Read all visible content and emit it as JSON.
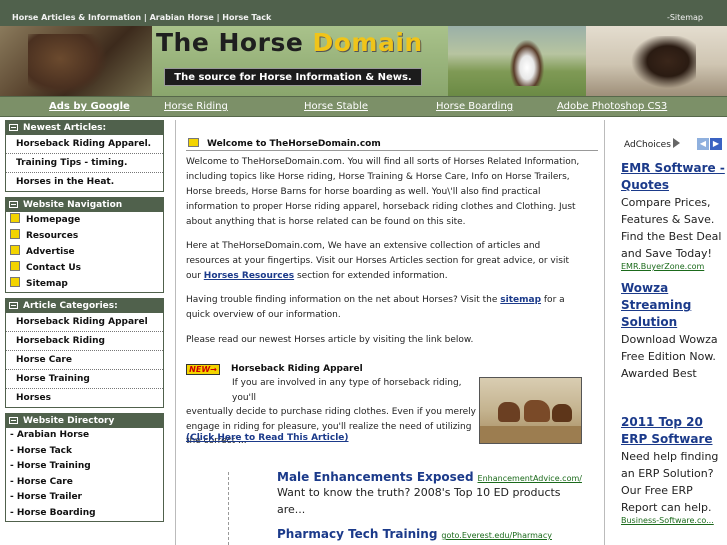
{
  "topbar": {
    "crumbs": "Horse Articles & Information | Arabian Horse | Horse Tack",
    "sitemap": "-Sitemap"
  },
  "banner": {
    "title_part1": "The Horse ",
    "title_part2": "Domain",
    "tagline": "The source for Horse Information & News."
  },
  "nav": {
    "items": [
      "Ads by Google",
      "Horse Riding",
      "Horse Stable",
      "Horse Boarding",
      "Adobe Photoshop CS3"
    ]
  },
  "sidebar": {
    "newest": {
      "heading": "Newest Articles:",
      "items": [
        "Horseback Riding Apparel.",
        "Training Tips - timing.",
        "Horses in the Heat."
      ]
    },
    "navigation": {
      "heading": "Website Navigation",
      "items": [
        "Homepage",
        "Resources",
        "Advertise",
        "Contact Us",
        "Sitemap"
      ]
    },
    "categories": {
      "heading": "Article Categories:",
      "items": [
        "Horseback Riding Apparel",
        "Horseback Riding",
        "Horse Care",
        "Horse Training",
        "Horses"
      ]
    },
    "directory": {
      "heading": "Website Directory",
      "items": [
        "- Arabian Horse",
        "- Horse Tack",
        "- Horse Training",
        "- Horse Care",
        "- Horse Trailer",
        "- Horse Boarding"
      ]
    }
  },
  "main": {
    "welcome": "Welcome to TheHorseDomain.com",
    "p1": "Welcome to TheHorseDomain.com. You will find all sorts of Horses Related Information, including topics like Horse riding, Horse Training & Horse Care, Info on Horse Trailers, Horse breeds, Horse Barns for horse boarding as well. You\\'ll also find practical information to proper Horse riding apparel, horseback riding clothes and Clothing. Just about anything that is horse related can be found on this site.",
    "p2_a": "Here at TheHorseDomain.com, We have an extensive collection of articles and resources at your fingertips. Visit our Horses Articles section for great advice, or visit our ",
    "p2_link": "Horses Resources",
    "p2_b": " section for extended information.",
    "p3_a": "Having trouble finding information on the net about Horses? Visit the ",
    "p3_link": "sitemap",
    "p3_b": " for a quick overview of our information.",
    "p4": "Please read our newest Horses article by visiting the link below.",
    "new_badge": "NEW→",
    "featured_title": "Horseback Riding Apparel",
    "featured_line1": "If you are involved in any type of horseback riding, you'll",
    "featured_rest": "eventually decide to purchase riding clothes. Even if you merely engage in riding for pleasure, you'll realize the need of utilizing the correct ...",
    "featured_link": "(Click Here to Read This Article)",
    "ads": [
      {
        "title": "Male Enhancements Exposed",
        "url": "EnhancementAdvice.com/",
        "desc": "Want to know the truth? 2008's Top 10 ED products are..."
      },
      {
        "title": "Pharmacy Tech Training",
        "url": "goto.Everest.edu/Pharmacy",
        "desc": ""
      }
    ]
  },
  "right_ads": {
    "adchoices": "AdChoices",
    "items": [
      {
        "title": "EMR Software - Quotes",
        "desc": "Compare Prices, Features & Save. Find the Best Deal and Save Today!",
        "url": "EMR.BuyerZone.com"
      },
      {
        "title": "Wowza Streaming Solution",
        "desc": "Download Wowza Free Edition Now. Awarded Best Media Streaming Server",
        "url": ""
      },
      {
        "title": "2011 Top 20 ERP Software",
        "desc": "Need help finding an ERP Solution? Our Free ERP Report can help.",
        "url": "Business-Software.co..."
      }
    ]
  },
  "colors": {
    "header_green": "#50614c",
    "nav_green": "#7c9068",
    "accent_yellow": "#f3d400",
    "link_blue": "#1b3a8a"
  }
}
